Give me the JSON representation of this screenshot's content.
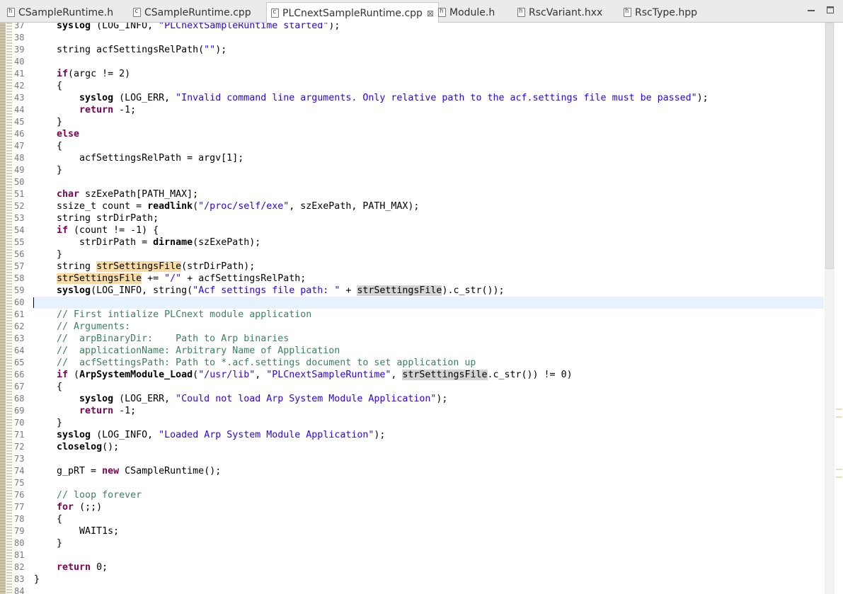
{
  "tabs": [
    {
      "label": "CSampleRuntime.h",
      "icon": "header-file-icon",
      "icon_letter": "h",
      "active": false
    },
    {
      "label": "CSampleRuntime.cpp",
      "icon": "cpp-file-icon",
      "icon_letter": "c",
      "active": false
    },
    {
      "label": "PLCnextSampleRuntime.cpp",
      "icon": "cpp-file-icon",
      "icon_letter": "c",
      "active": true
    },
    {
      "label": "Module.h",
      "icon": "header-file-icon",
      "icon_letter": "h",
      "active": false
    },
    {
      "label": "RscVariant.hxx",
      "icon": "header-file-icon",
      "icon_letter": "h",
      "active": false
    },
    {
      "label": "RscType.hpp",
      "icon": "header-file-icon",
      "icon_letter": "h",
      "active": false
    }
  ],
  "close_glyph": "⊠",
  "window_controls": {
    "minimize": "minimize-icon",
    "maximize": "maximize-icon"
  },
  "editor": {
    "current_line": "60",
    "highlight_colors": {
      "occurrence": "#f6dca4",
      "occurrence_read": "#d4d4d4",
      "current_line": "#e8f2fe"
    },
    "lines": [
      {
        "n": "37",
        "t": [
          [
            "    ",
            ""
          ],
          [
            "syslog",
            "fn"
          ],
          [
            " (LOG_INFO, ",
            ""
          ],
          [
            "\"PLCnextSampleRuntime started\"",
            "str"
          ],
          [
            ");",
            ""
          ]
        ]
      },
      {
        "n": "38",
        "t": []
      },
      {
        "n": "39",
        "t": [
          [
            "    string acfSettingsRelPath(",
            ""
          ],
          [
            "\"\"",
            "str"
          ],
          [
            ");",
            ""
          ]
        ]
      },
      {
        "n": "40",
        "t": []
      },
      {
        "n": "41",
        "t": [
          [
            "    ",
            ""
          ],
          [
            "if",
            "kw"
          ],
          [
            "(argc != 2)",
            ""
          ]
        ]
      },
      {
        "n": "42",
        "t": [
          [
            "    {",
            ""
          ]
        ]
      },
      {
        "n": "43",
        "t": [
          [
            "        ",
            ""
          ],
          [
            "syslog",
            "fn"
          ],
          [
            " (LOG_ERR, ",
            ""
          ],
          [
            "\"Invalid command line arguments. Only relative path to the acf.settings file must be passed\"",
            "str"
          ],
          [
            ");",
            ""
          ]
        ]
      },
      {
        "n": "44",
        "t": [
          [
            "        ",
            ""
          ],
          [
            "return",
            "kw"
          ],
          [
            " -1;",
            ""
          ]
        ]
      },
      {
        "n": "45",
        "t": [
          [
            "    }",
            ""
          ]
        ]
      },
      {
        "n": "46",
        "t": [
          [
            "    ",
            ""
          ],
          [
            "else",
            "kw"
          ]
        ]
      },
      {
        "n": "47",
        "t": [
          [
            "    {",
            ""
          ]
        ]
      },
      {
        "n": "48",
        "t": [
          [
            "        acfSettingsRelPath = argv[1];",
            ""
          ]
        ]
      },
      {
        "n": "49",
        "t": [
          [
            "    }",
            ""
          ]
        ]
      },
      {
        "n": "50",
        "t": []
      },
      {
        "n": "51",
        "t": [
          [
            "    ",
            ""
          ],
          [
            "char",
            "kw"
          ],
          [
            " szExePath[PATH_MAX];",
            ""
          ]
        ]
      },
      {
        "n": "52",
        "t": [
          [
            "    ssize_t count = ",
            ""
          ],
          [
            "readlink",
            "fn"
          ],
          [
            "(",
            ""
          ],
          [
            "\"/proc/self/exe\"",
            "str"
          ],
          [
            ", szExePath, PATH_MAX);",
            ""
          ]
        ]
      },
      {
        "n": "53",
        "t": [
          [
            "    string strDirPath;",
            ""
          ]
        ]
      },
      {
        "n": "54",
        "t": [
          [
            "    ",
            ""
          ],
          [
            "if",
            "kw"
          ],
          [
            " (count != -1) {",
            ""
          ]
        ]
      },
      {
        "n": "55",
        "t": [
          [
            "        strDirPath = ",
            ""
          ],
          [
            "dirname",
            "fn"
          ],
          [
            "(szExePath);",
            ""
          ]
        ]
      },
      {
        "n": "56",
        "t": [
          [
            "    }",
            ""
          ]
        ]
      },
      {
        "n": "57",
        "t": [
          [
            "    string ",
            ""
          ],
          [
            "strSettingsFile",
            "hl1"
          ],
          [
            "(strDirPath);",
            ""
          ]
        ]
      },
      {
        "n": "58",
        "t": [
          [
            "    ",
            ""
          ],
          [
            "strSettingsFile",
            "hl1"
          ],
          [
            " += ",
            ""
          ],
          [
            "\"/\"",
            "str"
          ],
          [
            " + acfSettingsRelPath;",
            ""
          ]
        ]
      },
      {
        "n": "59",
        "t": [
          [
            "    ",
            ""
          ],
          [
            "syslog",
            "fn"
          ],
          [
            "(LOG_INFO, string(",
            ""
          ],
          [
            "\"Acf settings file path: \"",
            "str"
          ],
          [
            " + ",
            ""
          ],
          [
            "strSettingsFile",
            "hl2"
          ],
          [
            ").c_str());",
            ""
          ]
        ]
      },
      {
        "n": "60",
        "t": []
      },
      {
        "n": "61",
        "t": [
          [
            "    ",
            ""
          ],
          [
            "// First intialize PLCnext module application",
            "cm"
          ]
        ]
      },
      {
        "n": "62",
        "t": [
          [
            "    ",
            ""
          ],
          [
            "// Arguments:",
            "cm"
          ]
        ]
      },
      {
        "n": "63",
        "t": [
          [
            "    ",
            ""
          ],
          [
            "//  arpBinaryDir:    Path to Arp binaries",
            "cm"
          ]
        ]
      },
      {
        "n": "64",
        "t": [
          [
            "    ",
            ""
          ],
          [
            "//  applicationName: Arbitrary Name of Application",
            "cm"
          ]
        ]
      },
      {
        "n": "65",
        "t": [
          [
            "    ",
            ""
          ],
          [
            "//  acfSettingsPath: Path to *.acf.settings document to set application up",
            "cm"
          ]
        ]
      },
      {
        "n": "66",
        "t": [
          [
            "    ",
            ""
          ],
          [
            "if",
            "kw"
          ],
          [
            " (",
            ""
          ],
          [
            "ArpSystemModule_Load",
            "fn"
          ],
          [
            "(",
            ""
          ],
          [
            "\"/usr/lib\"",
            "str"
          ],
          [
            ", ",
            ""
          ],
          [
            "\"PLCnextSampleRuntime\"",
            "str"
          ],
          [
            ", ",
            ""
          ],
          [
            "strSettingsFile",
            "hl2"
          ],
          [
            ".c_str()) != 0)",
            ""
          ]
        ]
      },
      {
        "n": "67",
        "t": [
          [
            "    {",
            ""
          ]
        ]
      },
      {
        "n": "68",
        "t": [
          [
            "        ",
            ""
          ],
          [
            "syslog",
            "fn"
          ],
          [
            " (LOG_ERR, ",
            ""
          ],
          [
            "\"Could not load Arp System Module Application\"",
            "str"
          ],
          [
            ");",
            ""
          ]
        ]
      },
      {
        "n": "69",
        "t": [
          [
            "        ",
            ""
          ],
          [
            "return",
            "kw"
          ],
          [
            " -1;",
            ""
          ]
        ]
      },
      {
        "n": "70",
        "t": [
          [
            "    }",
            ""
          ]
        ]
      },
      {
        "n": "71",
        "t": [
          [
            "    ",
            ""
          ],
          [
            "syslog",
            "fn"
          ],
          [
            " (LOG_INFO, ",
            ""
          ],
          [
            "\"Loaded Arp System Module Application\"",
            "str"
          ],
          [
            ");",
            ""
          ]
        ]
      },
      {
        "n": "72",
        "t": [
          [
            "    ",
            ""
          ],
          [
            "closelog",
            "fn"
          ],
          [
            "();",
            ""
          ]
        ]
      },
      {
        "n": "73",
        "t": []
      },
      {
        "n": "74",
        "t": [
          [
            "    g_pRT = ",
            ""
          ],
          [
            "new",
            "kw"
          ],
          [
            " CSampleRuntime();",
            ""
          ]
        ]
      },
      {
        "n": "75",
        "t": []
      },
      {
        "n": "76",
        "t": [
          [
            "    ",
            ""
          ],
          [
            "// loop forever",
            "cm"
          ]
        ]
      },
      {
        "n": "77",
        "t": [
          [
            "    ",
            ""
          ],
          [
            "for",
            "kw"
          ],
          [
            " (;;)",
            ""
          ]
        ]
      },
      {
        "n": "78",
        "t": [
          [
            "    {",
            ""
          ]
        ]
      },
      {
        "n": "79",
        "t": [
          [
            "        WAIT1s;",
            ""
          ]
        ]
      },
      {
        "n": "80",
        "t": [
          [
            "    }",
            ""
          ]
        ]
      },
      {
        "n": "81",
        "t": []
      },
      {
        "n": "82",
        "t": [
          [
            "    ",
            ""
          ],
          [
            "return",
            "kw"
          ],
          [
            " 0;",
            ""
          ]
        ]
      },
      {
        "n": "83",
        "t": [
          [
            "}",
            ""
          ]
        ]
      },
      {
        "n": "84",
        "t": []
      }
    ]
  }
}
